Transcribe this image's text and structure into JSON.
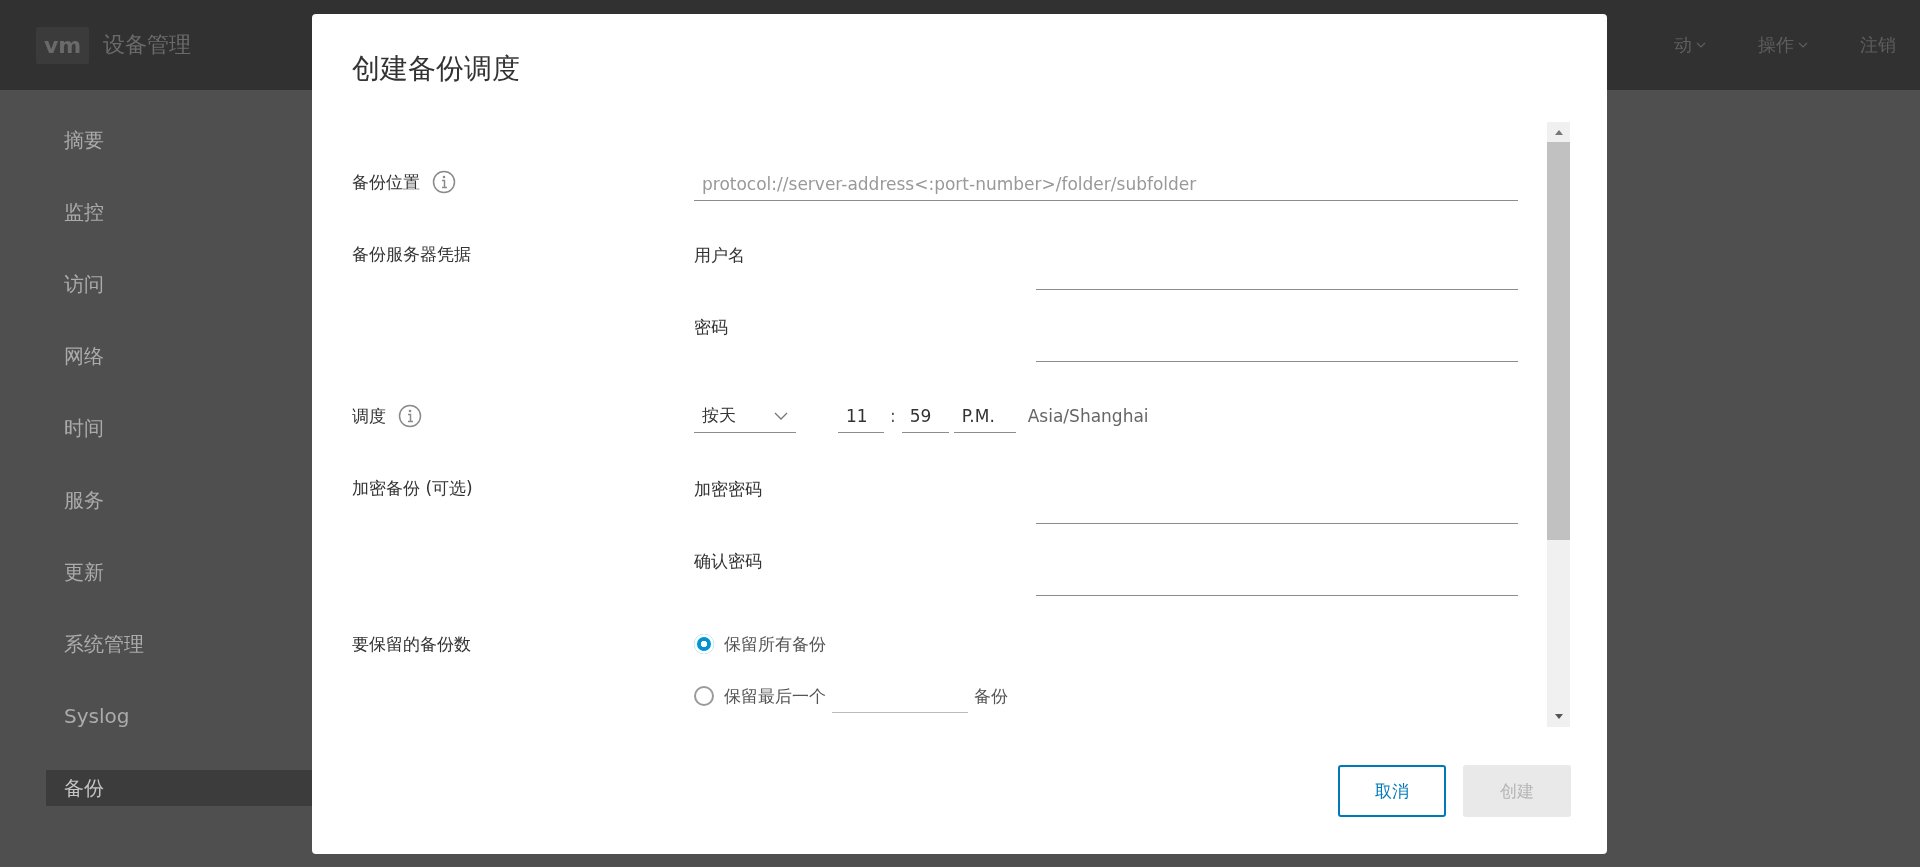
{
  "header": {
    "logo": "vm",
    "title": "设备管理",
    "actions": [
      {
        "label": "动",
        "dropdown": true
      },
      {
        "label": "操作",
        "dropdown": true
      },
      {
        "label": "注销",
        "dropdown": false
      }
    ]
  },
  "sidebar": {
    "items": [
      {
        "label": "摘要",
        "selected": false
      },
      {
        "label": "监控",
        "selected": false
      },
      {
        "label": "访问",
        "selected": false
      },
      {
        "label": "网络",
        "selected": false
      },
      {
        "label": "时间",
        "selected": false
      },
      {
        "label": "服务",
        "selected": false
      },
      {
        "label": "更新",
        "selected": false
      },
      {
        "label": "系统管理",
        "selected": false
      },
      {
        "label": "Syslog",
        "selected": false
      },
      {
        "label": "备份",
        "selected": true
      }
    ]
  },
  "dialog": {
    "title": "创建备份调度",
    "groups": [
      {
        "kind": "text",
        "label": "备份位置",
        "info": true,
        "placeholder": "protocol://server-address<:port-number>/folder/subfolder"
      },
      {
        "kind": "credentials",
        "label": "备份服务器凭据",
        "info": false,
        "subfields": [
          {
            "label": "用户名"
          },
          {
            "label": "密码"
          }
        ]
      },
      {
        "kind": "schedule",
        "label": "调度",
        "info": true,
        "frequency": "按天",
        "hour": "11",
        "separator": ":",
        "minute": "59",
        "meridiem": "P.M.",
        "timezone": "Asia/Shanghai"
      },
      {
        "kind": "credentials",
        "label": "加密备份 (可选)",
        "info": false,
        "subfields": [
          {
            "label": "加密密码"
          },
          {
            "label": "确认密码"
          }
        ]
      },
      {
        "kind": "retention",
        "label": "要保留的备份数",
        "info": false,
        "options": [
          {
            "label": "保留所有备份",
            "selected": true
          },
          {
            "label": "保留最后一个",
            "selected": false,
            "suffix": "备份"
          }
        ]
      }
    ],
    "buttons": [
      {
        "label": "取消",
        "disabled": false
      },
      {
        "label": "创建",
        "disabled": true
      }
    ]
  }
}
